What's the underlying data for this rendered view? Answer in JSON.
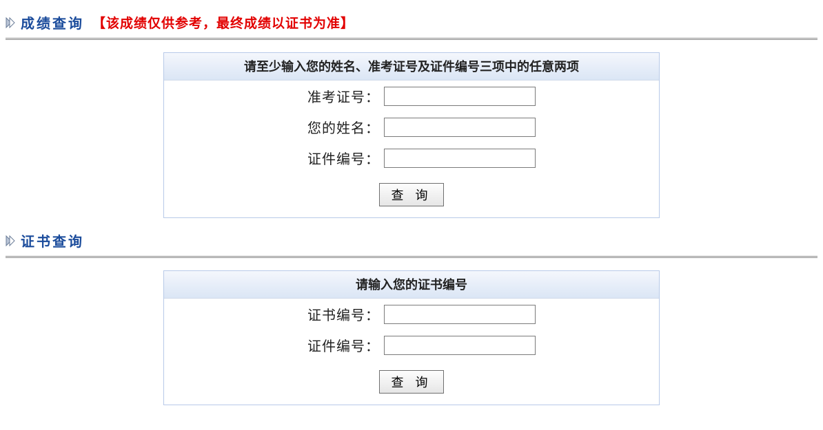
{
  "sections": {
    "score": {
      "title": "成绩查询",
      "notice": "【该成绩仅供参考，最终成绩以证书为准】",
      "header": "请至少输入您的姓名、准考证号及证件编号三项中的任意两项",
      "fields": {
        "ticket": {
          "label": "准考证号：",
          "value": ""
        },
        "name": {
          "label": "您的姓名：",
          "value": ""
        },
        "idno": {
          "label": "证件编号：",
          "value": ""
        }
      },
      "submit": "查 询"
    },
    "cert": {
      "title": "证书查询",
      "header": "请输入您的证书编号",
      "fields": {
        "certno1": {
          "label": "证书编号：",
          "value": ""
        },
        "certno2": {
          "label": "证件编号：",
          "value": ""
        }
      },
      "submit": "查 询"
    }
  }
}
